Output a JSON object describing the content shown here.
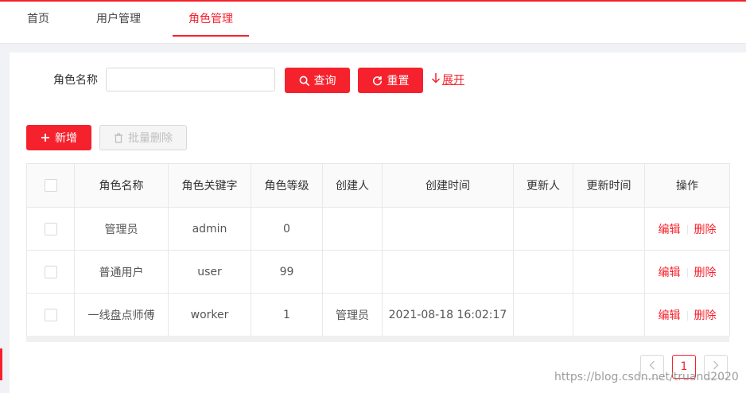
{
  "tabs": [
    {
      "label": "首页"
    },
    {
      "label": "用户管理"
    },
    {
      "label": "角色管理"
    }
  ],
  "colors": {
    "accent": "#f5222d"
  },
  "search": {
    "label": "角色名称",
    "value": "",
    "placeholder": "",
    "query_button": "查询",
    "reset_button": "重置",
    "expand_link": "展开"
  },
  "toolbar": {
    "add_button": "新增",
    "batch_delete_button": "批量删除"
  },
  "table": {
    "headers": [
      "角色名称",
      "角色关键字",
      "角色等级",
      "创建人",
      "创建时间",
      "更新人",
      "更新时间",
      "操作"
    ],
    "rows": [
      {
        "name": "管理员",
        "key": "admin",
        "level": "0",
        "creator": "",
        "created": "",
        "updater": "",
        "updated": ""
      },
      {
        "name": "普通用户",
        "key": "user",
        "level": "99",
        "creator": "",
        "created": "",
        "updater": "",
        "updated": ""
      },
      {
        "name": "一线盘点师傅",
        "key": "worker",
        "level": "1",
        "creator": "管理员",
        "created": "2021-08-18 16:02:17",
        "updater": "",
        "updated": ""
      }
    ],
    "edit_label": "编辑",
    "delete_label": "删除"
  },
  "pagination": {
    "current_page": "1"
  },
  "watermark": "https://blog.csdn.net/truand2020"
}
